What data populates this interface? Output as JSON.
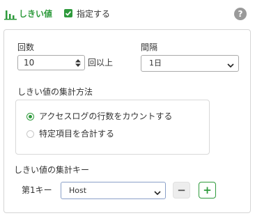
{
  "header": {
    "title": "しきい値",
    "enable_label": "指定する",
    "enable_checked": true,
    "title_icon": "bar-chart-icon",
    "help_icon": "help-icon",
    "help_glyph": "?",
    "accent_color": "#2e9a3c"
  },
  "count": {
    "label": "回数",
    "value": "10",
    "suffix": "回以上"
  },
  "interval": {
    "label": "間隔",
    "selected": "1日"
  },
  "method": {
    "label": "しきい値の集計方法",
    "options": [
      {
        "label": "アクセスログの行数をカウントする",
        "selected": true
      },
      {
        "label": "特定項目を合計する",
        "selected": false
      }
    ]
  },
  "keys": {
    "label": "しきい値の集計キー",
    "items": [
      {
        "label": "第1キー",
        "selected": "Host"
      }
    ],
    "remove_glyph": "−",
    "add_glyph": "+"
  }
}
